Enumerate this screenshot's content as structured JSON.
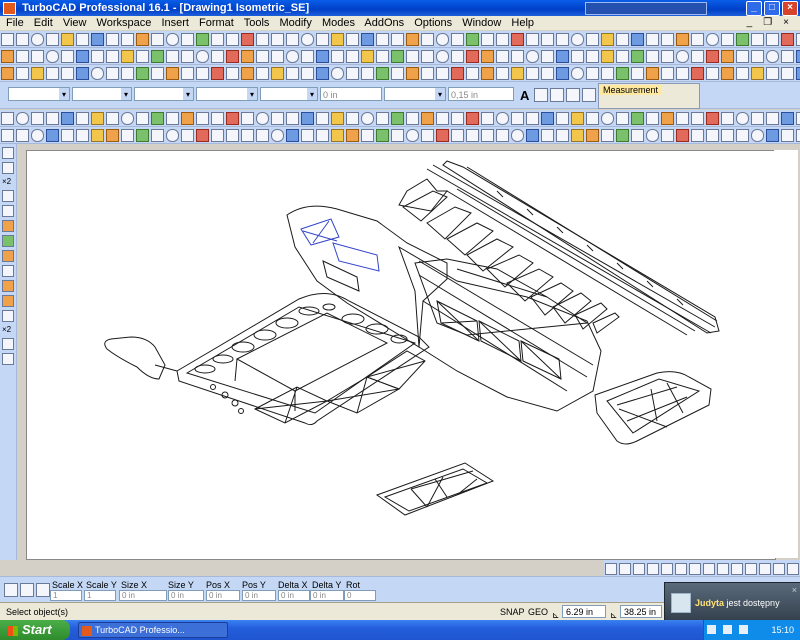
{
  "window": {
    "title": "TurboCAD Professional 16.1 - [Drawing1 Isometric_SE]",
    "controls": {
      "minimize": "_",
      "maximize": "□",
      "close": "×"
    }
  },
  "menu": {
    "items": [
      "File",
      "Edit",
      "View",
      "Workspace",
      "Insert",
      "Format",
      "Tools",
      "Modify",
      "Modes",
      "AddOns",
      "Options",
      "Window",
      "Help"
    ],
    "mdi_controls": [
      "_",
      "❐",
      "×"
    ]
  },
  "property_bar": {
    "dimension_field_1": "0 in",
    "dimension_field_2": "0,15 in"
  },
  "measurement_panel": {
    "title": "Measurement"
  },
  "inspector": {
    "labels": [
      "Scale X",
      "Scale Y",
      "Size X",
      "Size Y",
      "Pos X",
      "Pos Y",
      "Delta X",
      "Delta Y",
      "Rot"
    ],
    "values": [
      "1",
      "1",
      "0 in",
      "0 in",
      "0 in",
      "0 in",
      "0 in",
      "0 in",
      "0"
    ]
  },
  "status": {
    "message": "Select object(s)",
    "snap_label": "SNAP",
    "geo_label": "GEO",
    "coord_x": "6.29 in",
    "coord_y": "38.25 in"
  },
  "notification": {
    "name": "Judyta",
    "message": "jest dostępny",
    "close": "×"
  },
  "taskbar": {
    "start_label": "Start",
    "task_label": "TurboCAD Professio...",
    "clock": "15:10"
  },
  "colors": {
    "titlebar": "#0A5DE8",
    "toolbar": "#C4D7F4",
    "menubar": "#ECE9D8",
    "canvas": "#FFFFFF",
    "selection": "#3344CC",
    "start": "#3C9A38"
  },
  "icons": {
    "app": "turbocad-logo-icon",
    "select": "pointer-arrow-icon",
    "start": "windows-flag-icon"
  }
}
